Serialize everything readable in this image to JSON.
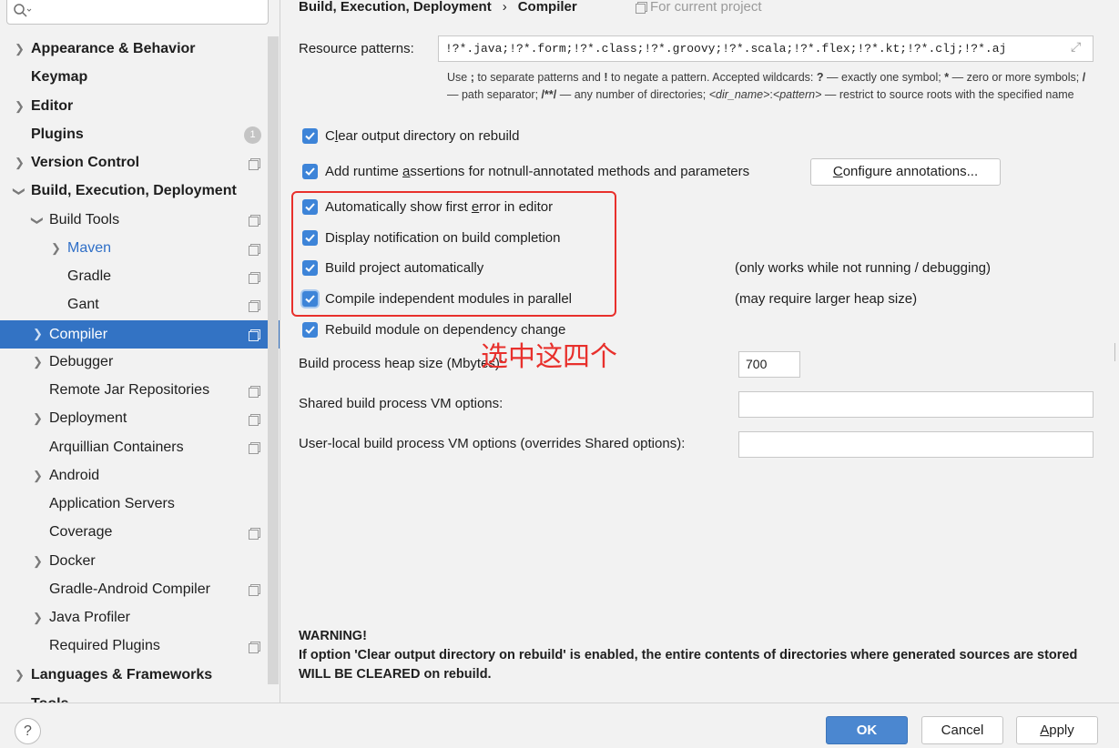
{
  "search": {
    "placeholder": ""
  },
  "sidebar": {
    "items": [
      {
        "label": "Appearance & Behavior"
      },
      {
        "label": "Keymap"
      },
      {
        "label": "Editor"
      },
      {
        "label": "Plugins",
        "badge": "1"
      },
      {
        "label": "Version Control"
      },
      {
        "label": "Build, Execution, Deployment"
      },
      {
        "label": "Build Tools"
      },
      {
        "label": "Maven"
      },
      {
        "label": "Gradle"
      },
      {
        "label": "Gant"
      },
      {
        "label": "Compiler"
      },
      {
        "label": "Debugger"
      },
      {
        "label": "Remote Jar Repositories"
      },
      {
        "label": "Deployment"
      },
      {
        "label": "Arquillian Containers"
      },
      {
        "label": "Android"
      },
      {
        "label": "Application Servers"
      },
      {
        "label": "Coverage"
      },
      {
        "label": "Docker"
      },
      {
        "label": "Gradle-Android Compiler"
      },
      {
        "label": "Java Profiler"
      },
      {
        "label": "Required Plugins"
      },
      {
        "label": "Languages & Frameworks"
      },
      {
        "label": "Tools"
      }
    ]
  },
  "header": {
    "breadcrumb_parent": "Build, Execution, Deployment",
    "breadcrumb_separator": "›",
    "breadcrumb_current": "Compiler",
    "scope": "For current project"
  },
  "resource": {
    "label": "Resource patterns:",
    "value": "!?*.java;!?*.form;!?*.class;!?*.groovy;!?*.scala;!?*.flex;!?*.kt;!?*.clj;!?*.aj",
    "hint_1": "Use",
    "hint_2": ";",
    "hint_3": "to separate patterns and",
    "hint_4": "!",
    "hint_5": "to negate a pattern. Accepted wildcards:",
    "hint_6": "?",
    "hint_7": "— exactly one symbol;",
    "hint_8": "*",
    "hint_9": "— zero or more symbols;",
    "hint_10": "/",
    "hint_11": "— path separator;",
    "hint_12": "/**/",
    "hint_13": "— any number of directories;",
    "hint_14": "<dir_name>",
    "hint_15": ":",
    "hint_16": "<pattern>",
    "hint_17": "— restrict to source roots with the specified name"
  },
  "options": {
    "clear_output": {
      "pre": "C",
      "u": "l",
      "post": "ear output directory on rebuild",
      "checked": true
    },
    "runtime_assertions": {
      "pre": "Add runtime ",
      "u": "a",
      "post": "ssertions for notnull-annotated methods and parameters",
      "checked": true
    },
    "configure_pre": "",
    "configure_u": "C",
    "configure_post": "onfigure annotations...",
    "show_first_error": {
      "pre": "Automatically show first ",
      "u": "e",
      "post": "rror in editor",
      "checked": true
    },
    "notification": {
      "label": "Display notification on build completion",
      "checked": true
    },
    "build_auto": {
      "label": "Build project automatically",
      "note": "(only works while not running / debugging)",
      "checked": true
    },
    "parallel": {
      "label": "Compile independent modules in parallel",
      "note": "(may require larger heap size)",
      "checked": true
    },
    "rebuild_dep": {
      "label": "Rebuild module on dependency change",
      "checked": true
    }
  },
  "heap": {
    "label": "Build process heap size (Mbytes):",
    "value": "700"
  },
  "shared_vm": {
    "label": "Shared build process VM options:",
    "value": ""
  },
  "user_vm": {
    "label": "User-local build process VM options (overrides Shared options):",
    "value": ""
  },
  "annotation_text": "选中这四个",
  "warning": {
    "title": "WARNING!",
    "body": "If option 'Clear output directory on rebuild' is enabled, the entire contents of directories where generated sources are stored WILL BE CLEARED on rebuild."
  },
  "footer": {
    "help": "?",
    "ok": "OK",
    "cancel": "Cancel",
    "apply_u": "A",
    "apply_post": "pply"
  },
  "colors": {
    "accent": "#3373c4",
    "annotation": "#e8302c",
    "checkbox": "#3d84d8"
  }
}
